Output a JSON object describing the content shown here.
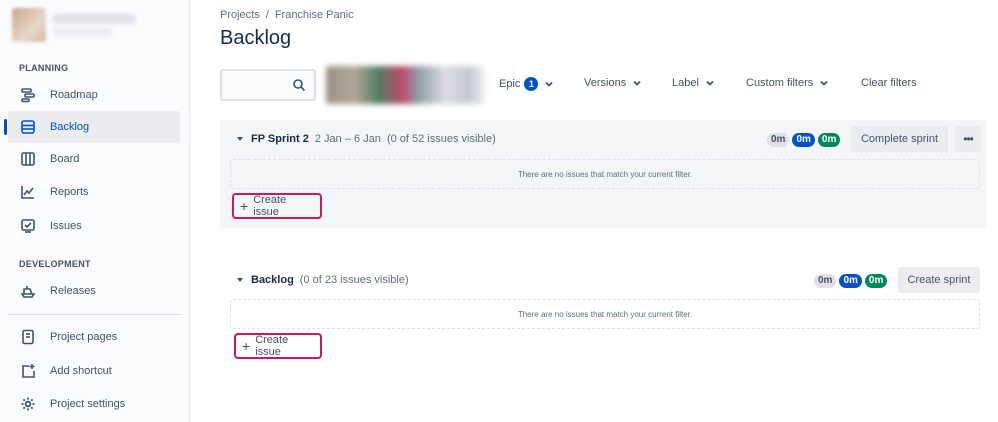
{
  "sidebar": {
    "sections": [
      {
        "label": "PLANNING",
        "items": [
          {
            "label": "Roadmap",
            "icon": "roadmap-icon"
          },
          {
            "label": "Backlog",
            "icon": "backlog-icon",
            "active": true
          },
          {
            "label": "Board",
            "icon": "board-icon"
          },
          {
            "label": "Reports",
            "icon": "reports-icon"
          },
          {
            "label": "Issues",
            "icon": "issues-icon"
          }
        ]
      },
      {
        "label": "DEVELOPMENT",
        "items": [
          {
            "label": "Releases",
            "icon": "releases-icon"
          }
        ]
      }
    ],
    "footer_items": [
      {
        "label": "Project pages",
        "icon": "page-icon"
      },
      {
        "label": "Add shortcut",
        "icon": "add-shortcut-icon"
      },
      {
        "label": "Project settings",
        "icon": "gear-icon"
      }
    ]
  },
  "breadcrumb": {
    "items": [
      "Projects",
      "Franchise Panic"
    ],
    "separator": "/"
  },
  "page": {
    "title": "Backlog"
  },
  "toolbar": {
    "search_placeholder": "",
    "filters": {
      "epic": {
        "label": "Epic",
        "count": "1"
      },
      "versions": "Versions",
      "label": "Label",
      "custom": "Custom filters",
      "clear": "Clear filters"
    }
  },
  "sprint": {
    "name": "FP Sprint 2",
    "dates": "2 Jan – 6 Jan",
    "visible": "(0 of 52 issues visible)",
    "estimates": [
      "0m",
      "0m",
      "0m"
    ],
    "complete_label": "Complete sprint",
    "more_label": "•••",
    "empty_text": "There are no issues that match your current filter.",
    "create_label": "Create issue"
  },
  "backlog": {
    "name": "Backlog",
    "visible": "(0 of 23 issues visible)",
    "estimates": [
      "0m",
      "0m",
      "0m"
    ],
    "create_sprint_label": "Create sprint",
    "empty_text": "There are no issues that match your current filter.",
    "create_label": "Create issue"
  },
  "colors": {
    "accent": "#0052cc",
    "success": "#00875a",
    "highlight_border": "#c9195f",
    "sidebar_bg": "#fafbfc",
    "sprint_bg": "#f4f5f7"
  }
}
